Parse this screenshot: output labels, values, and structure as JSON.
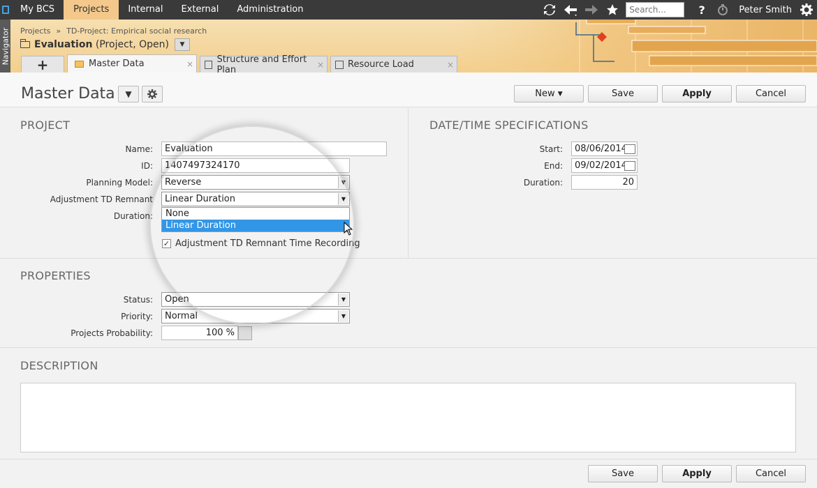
{
  "topnav": {
    "items": [
      "My BCS",
      "Projects",
      "Internal",
      "External",
      "Administration"
    ],
    "search_placeholder": "Search...",
    "help": "?",
    "user": "Peter Smith"
  },
  "navigator_label": "Navigator",
  "header": {
    "breadcrumb": [
      "Projects",
      "»",
      "TD-Project: Empirical social research"
    ],
    "title_bold": "Evaluation",
    "title_rest": "(Project, Open)"
  },
  "tabs": {
    "add": "+",
    "items": [
      "Master Data",
      "Structure and Effort Plan",
      "Resource Load"
    ],
    "close": "×"
  },
  "titlebar": {
    "title": "Master Data",
    "new_label": "New",
    "save_label": "Save",
    "apply_label": "Apply",
    "cancel_label": "Cancel"
  },
  "project": {
    "heading": "PROJECT",
    "name_label": "Name:",
    "name_value": "Evaluation",
    "id_label": "ID:",
    "id_value": "1407497324170",
    "planning_label": "Planning Model:",
    "planning_value": "Reverse",
    "adjust_label": "Adjustment TD Remnant",
    "adjust_value": "Linear Duration",
    "duration_label": "Duration:",
    "dropdown_options": [
      "None",
      "Linear Duration"
    ],
    "checkbox_label": "Adjustment TD Remnant Time Recording",
    "checkbox_checked": true
  },
  "datetime": {
    "heading": "DATE/TIME SPECIFICATIONS",
    "start_label": "Start:",
    "start_value": "08/06/2014",
    "end_label": "End:",
    "end_value": "09/02/2014",
    "duration_label": "Duration:",
    "duration_value": "20"
  },
  "properties": {
    "heading": "PROPERTIES",
    "status_label": "Status:",
    "status_value": "Open",
    "priority_label": "Priority:",
    "priority_value": "Normal",
    "probability_label": "Projects Probability:",
    "probability_value": "100 %"
  },
  "description": {
    "heading": "DESCRIPTION",
    "value": ""
  },
  "footer": {
    "save_label": "Save",
    "apply_label": "Apply",
    "cancel_label": "Cancel"
  },
  "colors": {
    "topbar": "#3a3a3a",
    "active_nav": "#f3c88a",
    "header_band": "#f3cf8e",
    "selection": "#3296e6"
  }
}
